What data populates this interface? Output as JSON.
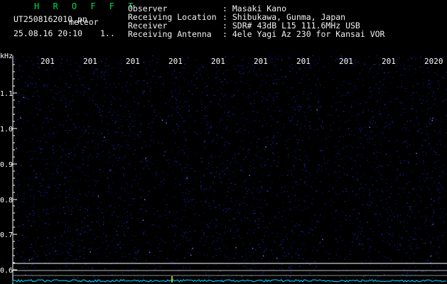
{
  "app": {
    "name": "H R O F F T",
    "filename": "UT2508162010.pn",
    "mode": "meteor",
    "datetime": "25.08.16 20:10",
    "marker": "1.."
  },
  "info": {
    "labels": [
      "Observer",
      "Receiving Location",
      "Receiver",
      "Receiving Antenna"
    ],
    "values": [
      ": Masaki Kano",
      ": Shibukawa, Gunma, Japan",
      ": SDR# 43dB L15 111.6MHz USB",
      ": 4ele Yagi Az 230 for Kansai VOR"
    ]
  },
  "axes": {
    "y_unit": "kHz",
    "y_ticks": [
      "1.1",
      "1.0",
      "0.9",
      "0.8",
      "0.7",
      "0.6"
    ],
    "x_ticks": [
      "201",
      "201",
      "201",
      "201",
      "201",
      "201",
      "201",
      "201",
      "201",
      "2020"
    ]
  },
  "colors": {
    "background": "#000000",
    "header_green": "#00d850",
    "header_text": "#f2f2f2",
    "axis": "#ffffff",
    "noise": "#1a22a0",
    "trace": "#00d8ff"
  }
}
